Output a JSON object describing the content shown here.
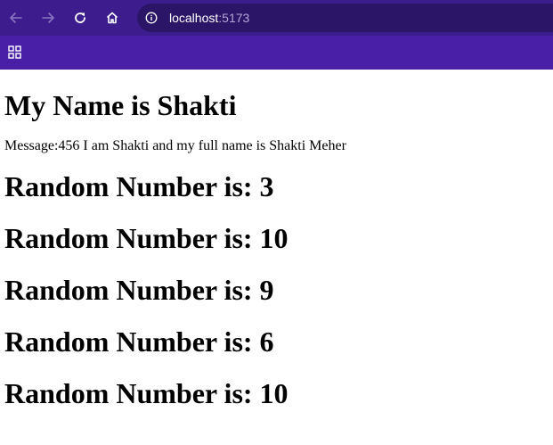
{
  "browser": {
    "url_host": "localhost",
    "url_port": ":5173"
  },
  "page": {
    "heading": "My Name is Shakti",
    "message": "Message:456 I am Shakti and my full name is Shakti Meher",
    "random_numbers": [
      "Random Number is: 3",
      "Random Number is: 10",
      "Random Number is: 9",
      "Random Number is: 6",
      "Random Number is: 10"
    ]
  }
}
